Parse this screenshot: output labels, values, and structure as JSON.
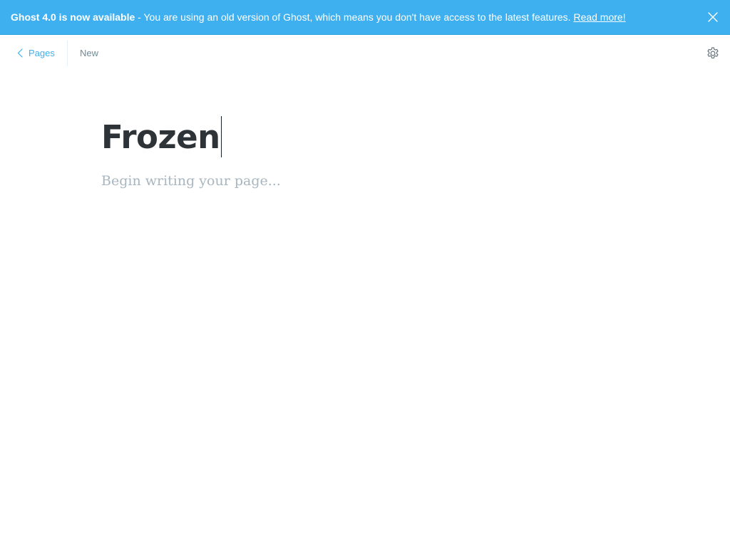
{
  "banner": {
    "strong": "Ghost 4.0 is now available",
    "message": " - You are using an old version of Ghost, which means you don't have access to the latest features. ",
    "link": "Read more!",
    "close_icon": "close-icon"
  },
  "header": {
    "back_label": "Pages",
    "back_icon": "chevron-left-icon",
    "status": "New",
    "settings_icon": "gear-icon"
  },
  "editor": {
    "title": "Frozen",
    "body_placeholder": "Begin writing your page..."
  },
  "colors": {
    "accent": "#3eb0ef",
    "title": "#2e3338",
    "placeholder": "#a8b6bf",
    "muted": "#738a94"
  }
}
